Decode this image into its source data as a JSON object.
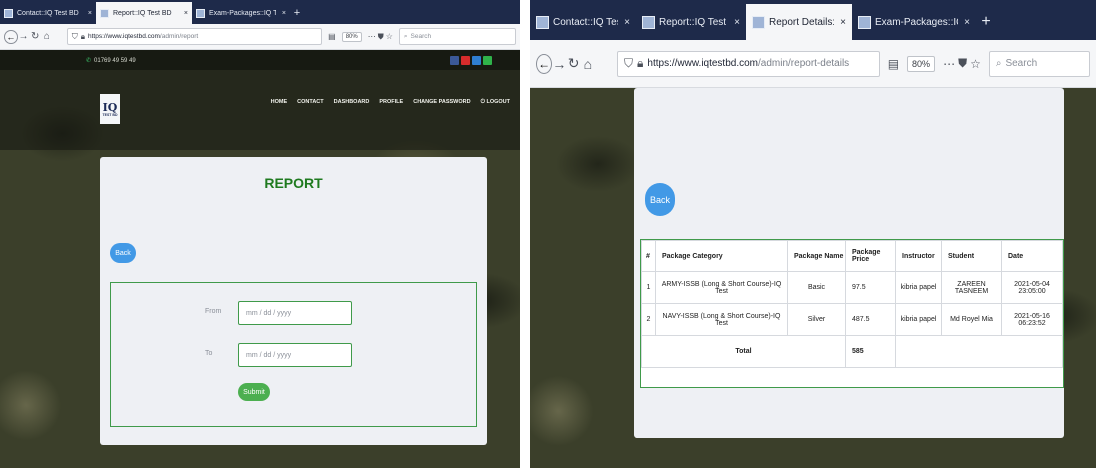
{
  "left": {
    "tabs": [
      {
        "title": "Contact::IQ Test BD",
        "close": "×"
      },
      {
        "title": "Report::IQ Test BD",
        "close": "×",
        "active": true
      },
      {
        "title": "Exam-Packages::IQ Test BD",
        "close": "×"
      }
    ],
    "new_tab": "+",
    "url": {
      "host": "https://www.iqtestbd.com",
      "path": "/admin/report"
    },
    "zoom": "80%",
    "search_placeholder": "Search",
    "phone": "01769 49 59 49",
    "logo_text": "IQ",
    "logo_sub": "TEST BD",
    "nav": [
      "HOME",
      "CONTACT",
      "DASHBOARD",
      "PROFILE",
      "CHANGE PASSWORD",
      "LOGOUT"
    ],
    "report_title": "REPORT",
    "back_label": "Back",
    "from_label": "From",
    "to_label": "To",
    "date_placeholder": "mm / dd / yyyy",
    "submit_label": "Submit"
  },
  "right": {
    "tabs": [
      {
        "title": "Contact::IQ Test BD",
        "close": "×"
      },
      {
        "title": "Report::IQ Test BD",
        "close": "×"
      },
      {
        "title": "Report Details::IQ Test BD",
        "close": "×",
        "active": true
      },
      {
        "title": "Exam-Packages::IQ Test BD",
        "close": "×"
      }
    ],
    "new_tab": "+",
    "url": {
      "host": "https://www.iqtestbd.com",
      "path": "/admin/report-details"
    },
    "zoom": "80%",
    "search_placeholder": "Search",
    "back_label": "Back",
    "table": {
      "headers": [
        "#",
        "Package Category",
        "Package Name",
        "Package Price",
        "Instructor",
        "Student",
        "Date"
      ],
      "rows": [
        [
          "1",
          "ARMY-ISSB (Long & Short Course)-IQ Test",
          "Basic",
          "97.5",
          "kibria papel",
          "ZAREEN TASNEEM",
          "2021-05-04 23:05:00"
        ],
        [
          "2",
          "NAVY-ISSB (Long & Short Course)-IQ Test",
          "Silver",
          "487.5",
          "kibria papel",
          "Md Royel Mia",
          "2021-05-16 06:23:52"
        ]
      ],
      "total_label": "Total",
      "total_value": "585"
    }
  },
  "colors": {
    "tabbar": "#1e2a4a",
    "report_title": "#1f7a1f",
    "back_button": "#4299e6",
    "submit_button": "#4caf50",
    "form_border": "#3f9a4a"
  },
  "icons": {
    "back": "arrow-left-icon",
    "forward": "arrow-right-icon",
    "reload": "reload-icon",
    "home": "home-icon",
    "shield": "shield-icon",
    "lock": "lock-icon",
    "reader": "reader-view-icon",
    "more": "more-icon",
    "pocket": "pocket-icon",
    "bookmark": "star-icon",
    "search": "search-icon"
  }
}
